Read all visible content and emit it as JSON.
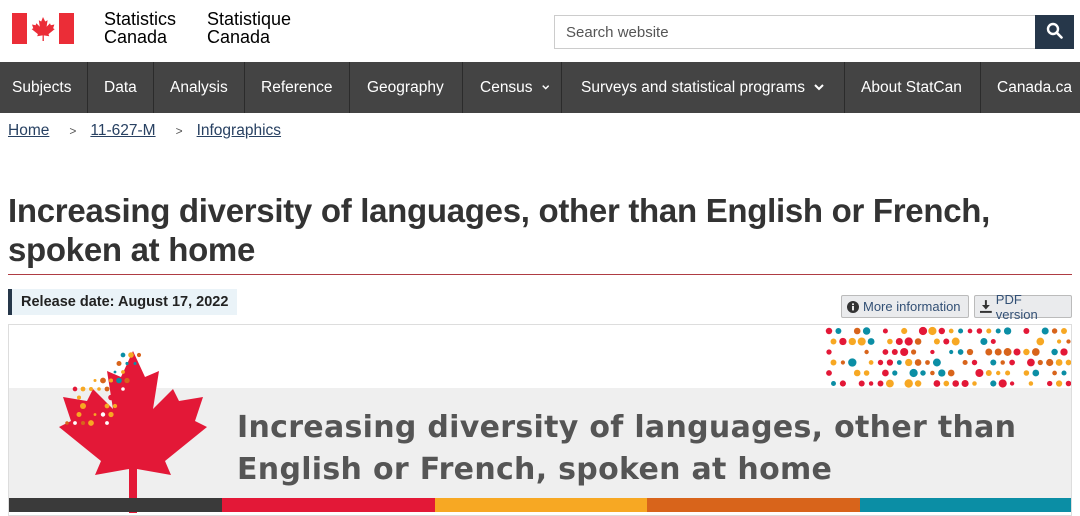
{
  "header": {
    "signature_en_line1": "Statistics",
    "signature_en_line2": "Canada",
    "signature_fr_line1": "Statistique",
    "signature_fr_line2": "Canada",
    "search_placeholder": "Search website"
  },
  "nav": {
    "items": [
      {
        "label": "Subjects"
      },
      {
        "label": "Data"
      },
      {
        "label": "Analysis"
      },
      {
        "label": "Reference"
      },
      {
        "label": "Geography"
      },
      {
        "label": "Census"
      },
      {
        "label": "Surveys and statistical programs"
      },
      {
        "label": "About StatCan"
      },
      {
        "label": "Canada.ca"
      }
    ]
  },
  "breadcrumb": {
    "items": [
      "Home",
      "11-627-M",
      "Infographics"
    ],
    "separator": ">"
  },
  "page": {
    "title": "Increasing diversity of languages, other than English or French, spoken at home",
    "release_date": "Release date: August 17, 2022",
    "more_info_label": "More information",
    "pdf_label": "PDF version"
  },
  "banner": {
    "line1": "Increasing diversity of languages, other than",
    "line2": "English or French, spoken at home",
    "stripe_colors": [
      "#3a3a3a",
      "#e31837",
      "#f7a823",
      "#d8641b",
      "#0b8ea5"
    ]
  },
  "colors": {
    "nav_bg": "#444444",
    "search_button": "#26374a",
    "link": "#284162",
    "flag_red": "#eb2d37",
    "title_rule": "#af3c43"
  },
  "icons": [
    "canada-flag-icon",
    "search-icon",
    "chevron-down-icon",
    "info-icon",
    "download-icon",
    "maple-leaf-icon"
  ]
}
